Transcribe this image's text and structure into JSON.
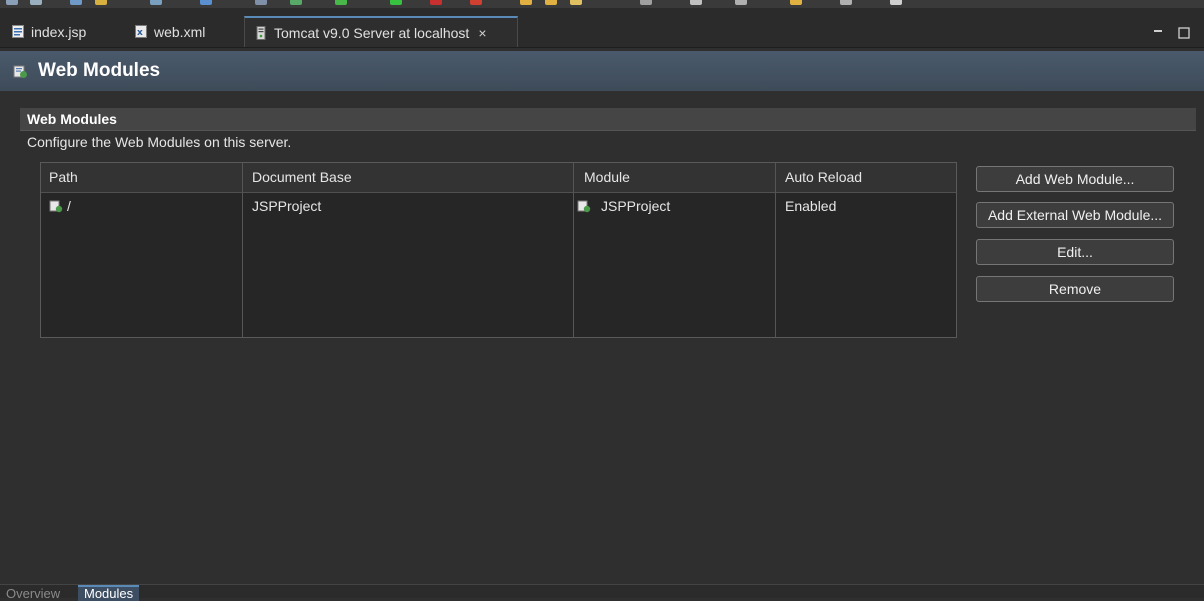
{
  "editor_tabs": [
    {
      "label": "index.jsp",
      "icon": "jsp-file-icon"
    },
    {
      "label": "web.xml",
      "icon": "xml-file-icon"
    },
    {
      "label": "Tomcat v9.0 Server at localhost",
      "icon": "tomcat-server-icon",
      "active": true,
      "close_label": "×"
    }
  ],
  "window_controls": {
    "minimize": "▭",
    "maximize": "□"
  },
  "form": {
    "title": "Web Modules",
    "icon": "web-module-icon"
  },
  "section": {
    "title": "Web Modules",
    "description": "Configure the Web Modules on this server."
  },
  "table": {
    "columns": [
      "Path",
      "Document Base",
      "Module",
      "Auto Reload"
    ],
    "rows": [
      {
        "path": "/",
        "document_base": "JSPProject",
        "module": "JSPProject",
        "auto_reload": "Enabled"
      }
    ]
  },
  "buttons": {
    "add_web_module": "Add Web Module...",
    "add_external_web_module": "Add External Web Module...",
    "edit": "Edit...",
    "remove": "Remove"
  },
  "page_tabs": [
    {
      "label": "Overview",
      "active": false
    },
    {
      "label": "Modules",
      "active": true
    }
  ],
  "colors": {
    "accent": "#5a8bb8",
    "header": "#4a5a6c",
    "background": "#2f2f2f"
  }
}
